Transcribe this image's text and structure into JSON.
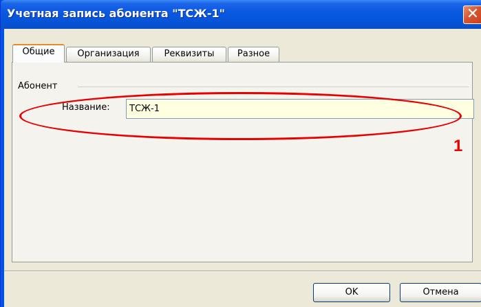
{
  "window": {
    "title": "Учетная запись абонента \"ТСЖ-1\"",
    "close_glyph": "✕"
  },
  "tabs": [
    {
      "label": "Общие",
      "active": true
    },
    {
      "label": "Организация",
      "active": false
    },
    {
      "label": "Реквизиты",
      "active": false
    },
    {
      "label": "Разное",
      "active": false
    }
  ],
  "subscriber_group": {
    "caption": "Абонент",
    "name_label": "Название:",
    "name_value": "ТСЖ-1"
  },
  "annotation": {
    "number": "1",
    "color": "#e60000"
  },
  "buttons": {
    "ok": "OK",
    "cancel": "Отмена"
  },
  "colors": {
    "titlebar": "#0858e0",
    "dialog_bg": "#ece9d8",
    "input_bg": "#ffffe1",
    "active_tab_accent": "#e68b2c"
  }
}
